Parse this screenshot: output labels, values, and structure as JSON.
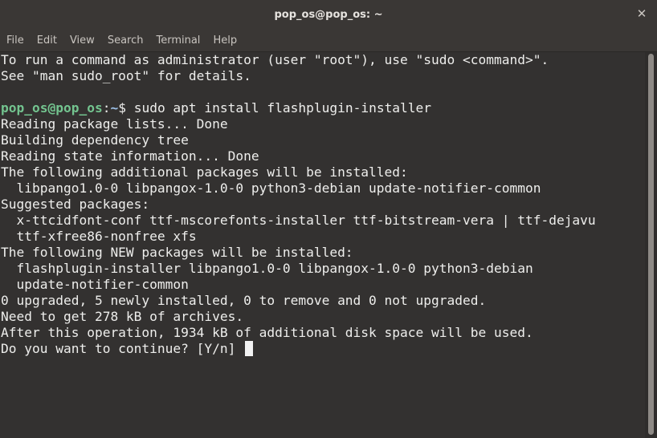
{
  "window": {
    "title": "pop_os@pop_os: ~",
    "close_glyph": "✕"
  },
  "menubar": {
    "items": [
      "File",
      "Edit",
      "View",
      "Search",
      "Terminal",
      "Help"
    ]
  },
  "terminal": {
    "intro_1": "To run a command as administrator (user \"root\"), use \"sudo <command>\".",
    "intro_2": "See \"man sudo_root\" for details.",
    "prompt_user": "pop_os@pop_os",
    "prompt_sep": ":",
    "prompt_path": "~",
    "prompt_symbol": "$ ",
    "command": "sudo apt install flashplugin-installer",
    "output": [
      "Reading package lists... Done",
      "Building dependency tree",
      "Reading state information... Done",
      "The following additional packages will be installed:",
      "  libpango1.0-0 libpangox-1.0-0 python3-debian update-notifier-common",
      "Suggested packages:",
      "  x-ttcidfont-conf ttf-mscorefonts-installer ttf-bitstream-vera | ttf-dejavu",
      "  ttf-xfree86-nonfree xfs",
      "The following NEW packages will be installed:",
      "  flashplugin-installer libpango1.0-0 libpangox-1.0-0 python3-debian",
      "  update-notifier-common",
      "0 upgraded, 5 newly installed, 0 to remove and 0 not upgraded.",
      "Need to get 278 kB of archives.",
      "After this operation, 1934 kB of additional disk space will be used."
    ],
    "question": "Do you want to continue? [Y/n] "
  },
  "colors": {
    "background": "#333130",
    "prompt_user": "#73c48f",
    "prompt_path": "#9dc0e8",
    "text": "#eeeeec"
  }
}
